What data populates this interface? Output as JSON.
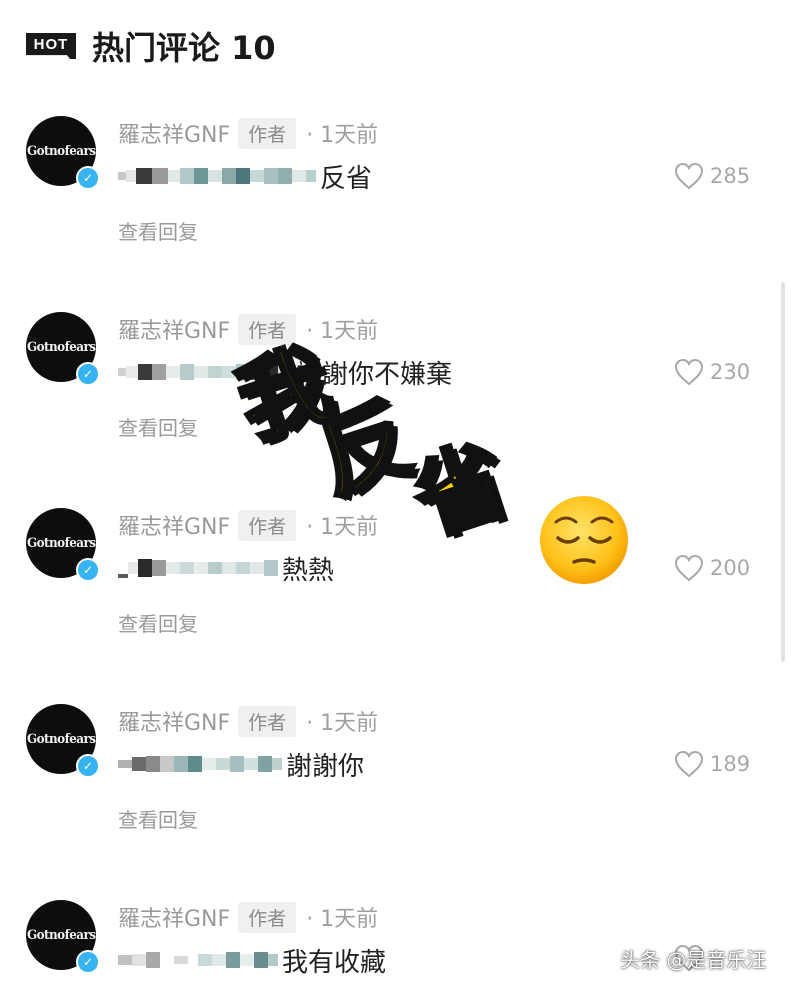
{
  "header": {
    "badge": "HOT",
    "title": "热门评论 10"
  },
  "author": {
    "name": "羅志祥GNF",
    "tag": "作者",
    "avatar_text": "Gotnofears"
  },
  "comments": [
    {
      "time": "· 1天前",
      "text": "反省",
      "likes": "285",
      "reply": "查看回复"
    },
    {
      "time": "· 1天前",
      "text": "謝謝你不嫌棄",
      "likes": "230",
      "reply": "查看回复"
    },
    {
      "time": "· 1天前",
      "text": "熱熱",
      "likes": "200",
      "reply": "查看回复"
    },
    {
      "time": "· 1天前",
      "text": "謝謝你",
      "likes": "189",
      "reply": "查看回复"
    },
    {
      "time": "· 1天前",
      "text": "我有收藏",
      "likes": "",
      "reply": ""
    }
  ],
  "overlay": {
    "chars": [
      "我",
      "反",
      "省"
    ],
    "emoji": "pensive-face"
  },
  "watermark": "头条 @是音乐汪",
  "colors": {
    "accent_yellow": "#ffcf00",
    "verified_blue": "#36b3f0",
    "muted_text": "#a0a0a0"
  }
}
